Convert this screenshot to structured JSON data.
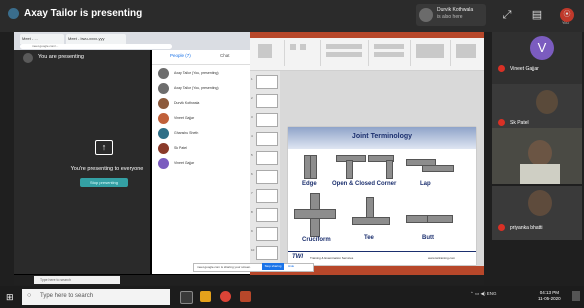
{
  "meeting": {
    "presenter_title": "Axay Tailor is presenting",
    "pinned_name": "Durvik Kothwala",
    "pinned_sub": "is also here",
    "top_labels": [
      "",
      "",
      "You"
    ]
  },
  "share": {
    "browser_tabs": [
      "Meet - ...",
      "Meet - bwu-xxxx-yyy"
    ],
    "address": "meet.google.com/...",
    "you_are_presenting": "You are presenting",
    "presenting_to_everyone": "You're presenting to everyone",
    "stop_presenting": "Stop presenting",
    "people_tab": "People (7)",
    "chat_tab": "Chat",
    "people": [
      {
        "name": "Axay Tailor (You, presenting)",
        "color": "#6d6d6d"
      },
      {
        "name": "Axay Tailor (You, presenting)",
        "color": "#6d6d6d"
      },
      {
        "name": "Durvik Kothwala",
        "color": "#8c5a3c"
      },
      {
        "name": "Vineet Gajjar",
        "color": "#c0603a"
      },
      {
        "name": "Ghanshu Sheth",
        "color": "#2f6f87"
      },
      {
        "name": "Sk Patel",
        "color": "#8a3a2a"
      },
      {
        "name": "Vineet Gajjar",
        "color": "#7b5cbf"
      }
    ],
    "notice": "meet.google.com is sharing your screen.",
    "notice_stop": "Stop sharing",
    "notice_hide": "Hide",
    "inner_search": "Type here to search"
  },
  "slide": {
    "title": "Joint Terminology",
    "labels": {
      "edge": "Edge",
      "corner": "Open & Closed Corner",
      "lap": "Lap",
      "cruciform": "Cruciform",
      "tee": "Tee",
      "butt": "Butt"
    },
    "footer_logo": "TWI",
    "footer_text": "Training & Examination Services",
    "footer_url": "www.twitraining.com",
    "thumb_numbers": [
      "1",
      "2",
      "3",
      "4",
      "5",
      "6",
      "7",
      "8",
      "9",
      "10"
    ]
  },
  "participants": [
    {
      "name": "Vineet Gajjar",
      "initial": "V",
      "avatar_color": "#7b5cbf"
    },
    {
      "name": "Sk Patel"
    },
    {
      "name": ""
    },
    {
      "name": "priyanka bhatti"
    }
  ],
  "taskbar": {
    "search_placeholder": "Type here to search",
    "time": "04:13 PM",
    "date": "11-05-2020",
    "lang": "ENG"
  }
}
